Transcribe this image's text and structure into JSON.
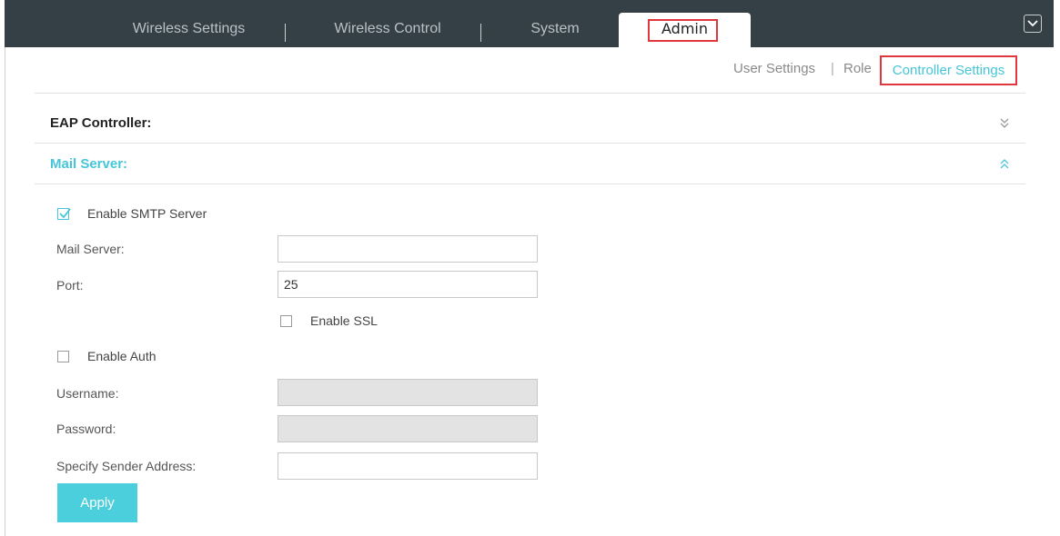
{
  "nav": {
    "tabs": [
      {
        "label": "Wireless Settings"
      },
      {
        "label": "Wireless Control"
      },
      {
        "label": "System"
      },
      {
        "label": "Admin"
      }
    ]
  },
  "subnav": {
    "user_settings": "User Settings",
    "separator": "|",
    "role": "Role",
    "controller_settings": "Controller Settings"
  },
  "sections": {
    "eap_controller": {
      "title": "EAP Controller:"
    },
    "mail_server": {
      "title": "Mail Server:"
    }
  },
  "form": {
    "enable_smtp": {
      "label": "Enable SMTP Server",
      "checked": true
    },
    "mail_server": {
      "label": "Mail Server:",
      "value": ""
    },
    "port": {
      "label": "Port:",
      "value": "25"
    },
    "enable_ssl": {
      "label": "Enable SSL",
      "checked": false
    },
    "enable_auth": {
      "label": "Enable Auth",
      "checked": false
    },
    "username": {
      "label": "Username:",
      "value": ""
    },
    "password": {
      "label": "Password:",
      "value": ""
    },
    "sender_address": {
      "label": "Specify Sender Address:",
      "value": ""
    },
    "apply_label": "Apply"
  },
  "colors": {
    "nav_bg": "#354046",
    "accent": "#45c6d8",
    "highlight": "#e0373d",
    "button": "#4ccfdc"
  }
}
